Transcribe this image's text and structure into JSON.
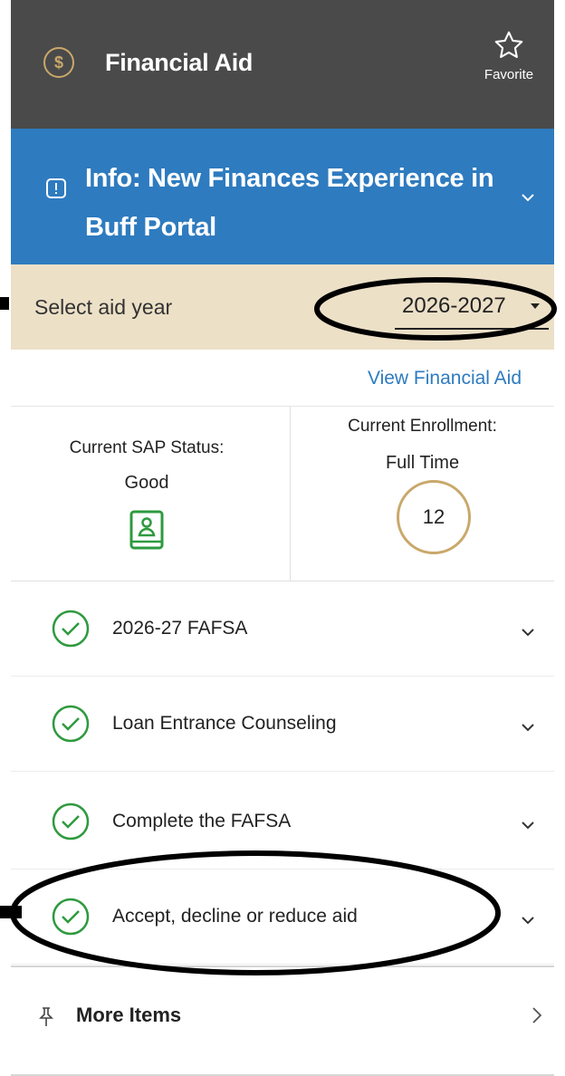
{
  "header": {
    "title": "Financial Aid",
    "favorite_label": "Favorite",
    "coin_symbol": "$",
    "bg_color": "#4a4a4a",
    "accent_color": "#c9a86a"
  },
  "banner": {
    "text": "Info: New Finances Experience in Buff Portal",
    "icon_glyph": "!",
    "bg_color": "#2e7bbf"
  },
  "aid_year": {
    "label": "Select aid year",
    "selected": "2026-2027",
    "bg_color": "#ece0c7"
  },
  "view_link": "View Financial Aid",
  "stats": {
    "sap_label": "Current SAP Status:",
    "sap_value": "Good",
    "enrollment_label": "Current Enrollment:",
    "enrollment_value": "Full Time",
    "credits": "12"
  },
  "checklist": [
    {
      "label": "2026-27 FAFSA",
      "status": "complete"
    },
    {
      "label": "Loan Entrance Counseling",
      "status": "complete"
    },
    {
      "label": "Complete the FAFSA",
      "status": "complete"
    },
    {
      "label": "Accept, decline or reduce aid",
      "status": "complete"
    }
  ],
  "more_items": "More Items",
  "colors": {
    "check_green": "#2e9a3e",
    "link_blue": "#2e7bbf"
  }
}
